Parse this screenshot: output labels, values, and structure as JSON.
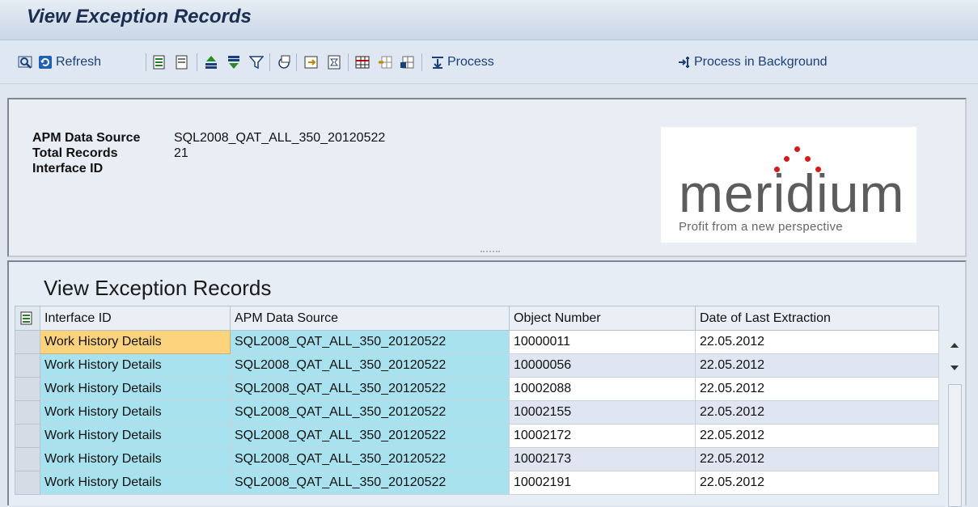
{
  "window": {
    "title": "View Exception Records"
  },
  "toolbar": {
    "refresh_label": "Refresh",
    "process_label": "Process",
    "process_background_label": "Process in Background",
    "icons": [
      "details-icon",
      "refresh-icon",
      "select-all-icon",
      "deselect-all-icon",
      "sort-ascending-icon",
      "sort-descending-icon",
      "filter-icon",
      "sum-icon",
      "export-icon",
      "print-icon",
      "layout-icon",
      "layout-change-icon",
      "layout-save-icon",
      "process-icon",
      "process-background-icon"
    ]
  },
  "header": {
    "fields": [
      {
        "label": "APM Data Source",
        "value": "SQL2008_QAT_ALL_350_20120522"
      },
      {
        "label": "Total Records",
        "value": "21"
      },
      {
        "label": "Interface ID",
        "value": ""
      }
    ],
    "logo": {
      "word": "meridium",
      "tagline": "Profit from a new perspective",
      "accent": "#d41b1b"
    }
  },
  "grid": {
    "title": "View Exception Records",
    "columns": [
      "Interface ID",
      "APM Data Source",
      "Object Number",
      "Date of Last Extraction"
    ],
    "rows": [
      [
        "Work History Details",
        "SQL2008_QAT_ALL_350_20120522",
        "10000011",
        "22.05.2012"
      ],
      [
        "Work History Details",
        "SQL2008_QAT_ALL_350_20120522",
        "10000056",
        "22.05.2012"
      ],
      [
        "Work History Details",
        "SQL2008_QAT_ALL_350_20120522",
        "10002088",
        "22.05.2012"
      ],
      [
        "Work History Details",
        "SQL2008_QAT_ALL_350_20120522",
        "10002155",
        "22.05.2012"
      ],
      [
        "Work History Details",
        "SQL2008_QAT_ALL_350_20120522",
        "10002172",
        "22.05.2012"
      ],
      [
        "Work History Details",
        "SQL2008_QAT_ALL_350_20120522",
        "10002173",
        "22.05.2012"
      ],
      [
        "Work History Details",
        "SQL2008_QAT_ALL_350_20120522",
        "10002191",
        "22.05.2012"
      ]
    ],
    "colors": {
      "key_cell": "#a8e2ee",
      "focused_cell": "#fbd37c",
      "alt_row": "#dfe6f2"
    }
  }
}
